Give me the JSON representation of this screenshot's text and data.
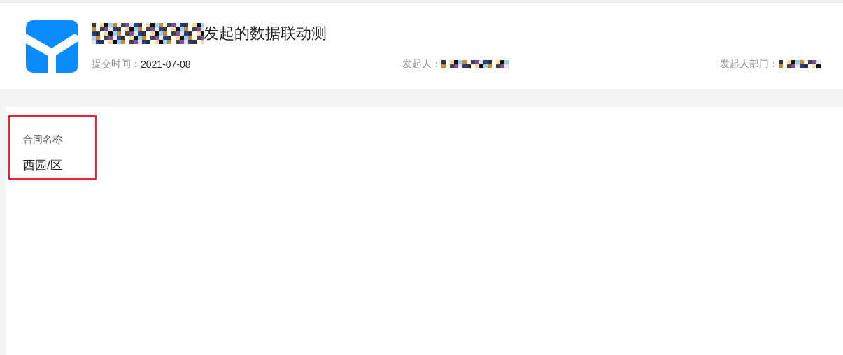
{
  "header": {
    "title": "发起的数据联动测",
    "meta": [
      {
        "label": "提交时间：",
        "value": "2021-07-08",
        "redacted": false
      },
      {
        "label": "发起人：",
        "redacted": true
      },
      {
        "label": "发起人部门：",
        "redacted": true
      }
    ]
  },
  "fields": [
    {
      "label": "合同名称",
      "value": "西园/区",
      "highlighted": true
    }
  ]
}
